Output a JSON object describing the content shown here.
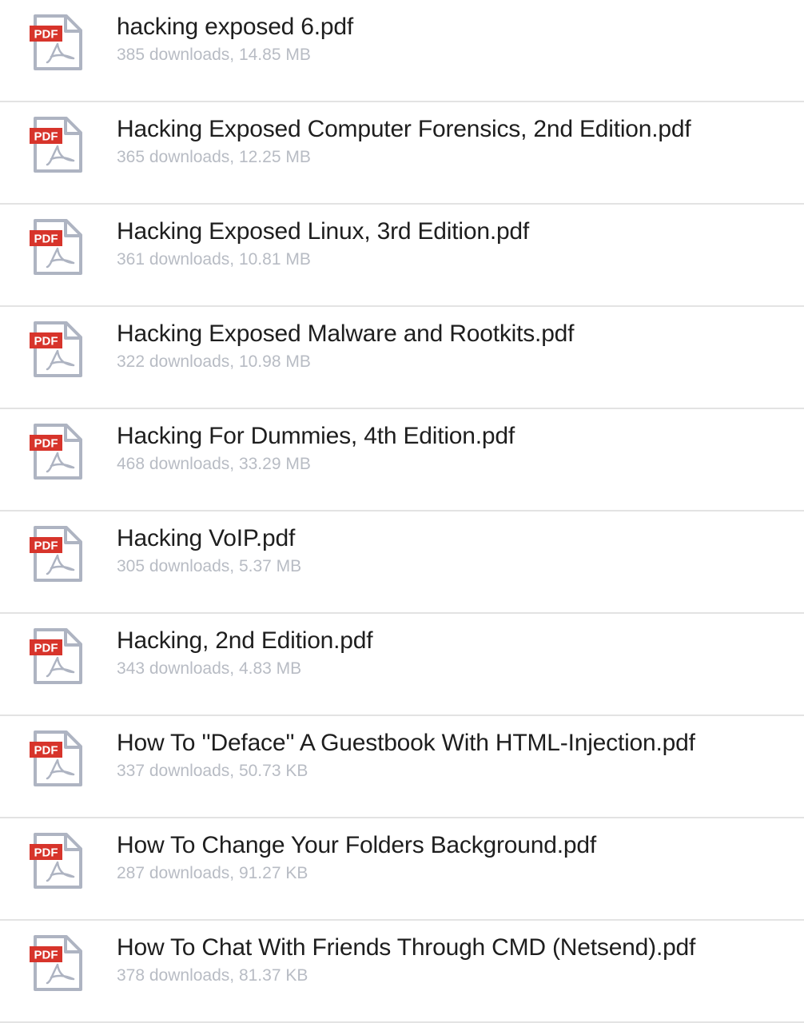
{
  "colors": {
    "pdf_badge": "#d7342b",
    "doc_outline": "#aeb4c2",
    "title_text": "#1e1e1e",
    "meta_text": "#b8bcc4",
    "divider": "#e3e3e3"
  },
  "icon": {
    "name": "pdf-file-icon",
    "badge_text": "PDF"
  },
  "files": [
    {
      "name": "hacking exposed 6.pdf",
      "downloads": "385 downloads",
      "size": "14.85 MB"
    },
    {
      "name": "Hacking Exposed Computer Forensics, 2nd Edition.pdf",
      "downloads": "365 downloads",
      "size": "12.25 MB"
    },
    {
      "name": "Hacking Exposed Linux, 3rd Edition.pdf",
      "downloads": "361 downloads",
      "size": "10.81 MB"
    },
    {
      "name": "Hacking Exposed Malware and Rootkits.pdf",
      "downloads": "322 downloads",
      "size": "10.98 MB"
    },
    {
      "name": "Hacking For Dummies, 4th Edition.pdf",
      "downloads": "468 downloads",
      "size": "33.29 MB"
    },
    {
      "name": "Hacking VoIP.pdf",
      "downloads": "305 downloads",
      "size": "5.37 MB"
    },
    {
      "name": "Hacking, 2nd Edition.pdf",
      "downloads": "343 downloads",
      "size": "4.83 MB"
    },
    {
      "name": "How To ''Deface'' A Guestbook With HTML-Injection.pdf",
      "downloads": "337 downloads",
      "size": "50.73 KB"
    },
    {
      "name": "How To Change Your Folders Background.pdf",
      "downloads": "287 downloads",
      "size": "91.27 KB"
    },
    {
      "name": "How To Chat With Friends Through CMD (Netsend).pdf",
      "downloads": "378 downloads",
      "size": "81.37 KB"
    }
  ]
}
